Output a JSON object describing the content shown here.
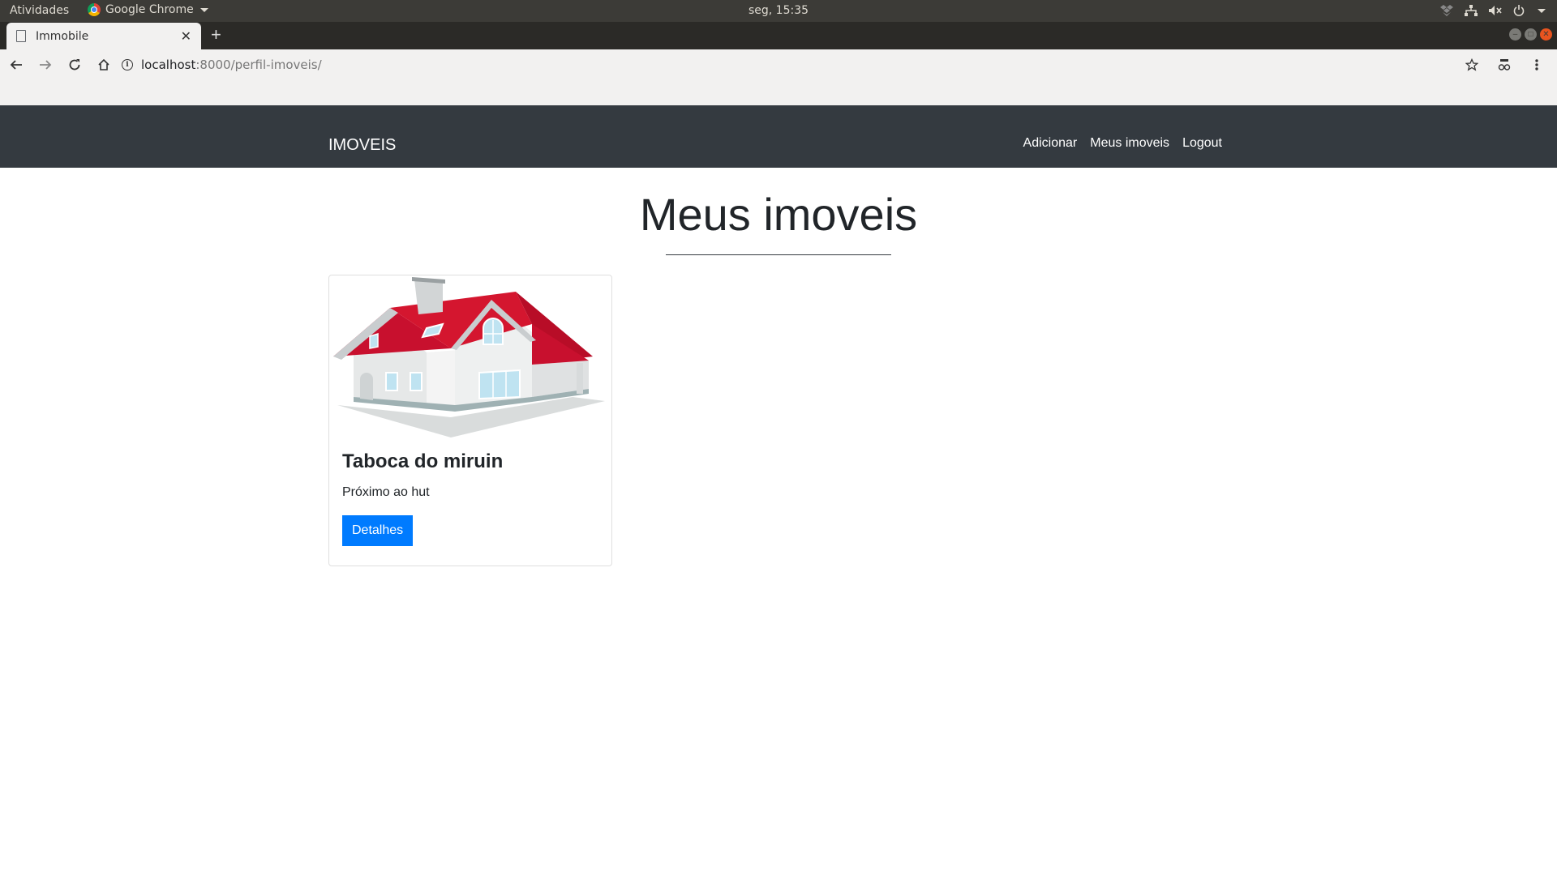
{
  "os_bar": {
    "activities": "Atividades",
    "app_name": "Google Chrome",
    "clock": "seg, 15:35"
  },
  "browser": {
    "tab_title": "Immobile",
    "url_host": "localhost",
    "url_path": ":8000/perfil-imoveis/"
  },
  "navbar": {
    "brand": "IMOVEIS",
    "links": [
      "Adicionar",
      "Meus imoveis",
      "Logout"
    ]
  },
  "main": {
    "title": "Meus imoveis",
    "cards": [
      {
        "title": "Taboca do miruin",
        "text": "Próximo ao hut",
        "button_label": "Detalhes"
      }
    ]
  },
  "colors": {
    "navbar_bg": "#343a40",
    "button_primary": "#007bff",
    "roof_red": "#c8102e"
  }
}
